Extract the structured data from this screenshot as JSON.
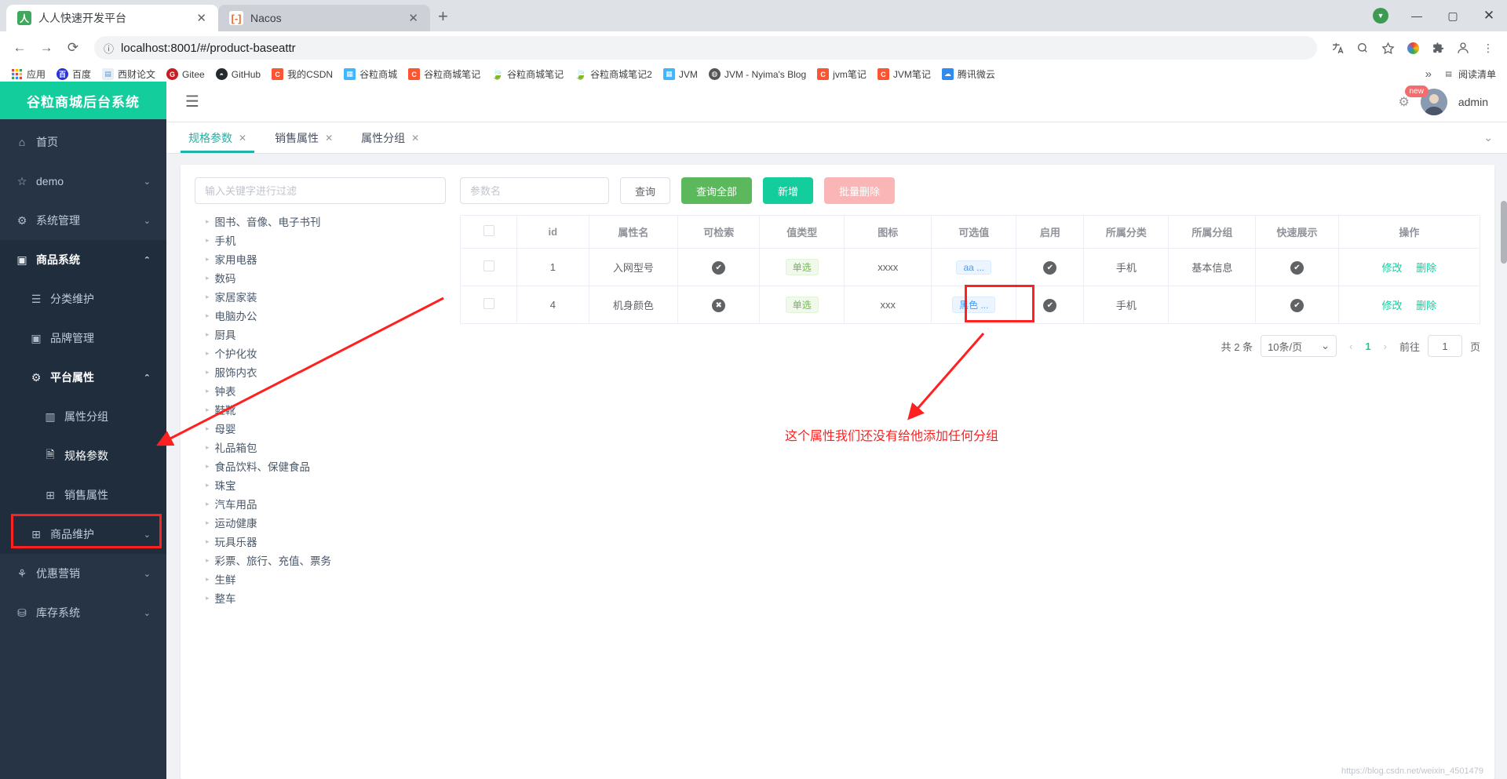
{
  "browser": {
    "tabs": [
      {
        "title": "人人快速开发平台",
        "favicon": "人",
        "active": true,
        "close": "✕"
      },
      {
        "title": "Nacos",
        "favicon": "[-]",
        "active": false,
        "close": "✕"
      }
    ],
    "newtab_label": "+",
    "window_controls": {
      "minimize": "—",
      "maximize": "▢",
      "close": "✕",
      "shield": "▼"
    },
    "nav": {
      "back": "←",
      "forward": "→",
      "reload": "⟳"
    },
    "url": "localhost:8001/#/product-baseattr",
    "url_info_icon": "ⓘ",
    "toolbar_icons": [
      "translate-icon",
      "search-icon",
      "star-icon",
      "extension-puzzle-icon",
      "profile-icon"
    ],
    "bookmarks": [
      {
        "label": "应用",
        "icon": "apps-grid-icon",
        "color": "#4285f4"
      },
      {
        "label": "百度",
        "icon": "baidu-icon",
        "color": "#2932e1"
      },
      {
        "label": "西财论文",
        "icon": "document-icon",
        "color": "#5b9bd5"
      },
      {
        "label": "Gitee",
        "icon": "gitee-icon",
        "color": "#c71d23"
      },
      {
        "label": "GitHub",
        "icon": "github-icon",
        "color": "#24292e"
      },
      {
        "label": "我的CSDN",
        "icon": "csdn-icon",
        "color": "#fc5531"
      },
      {
        "label": "谷粒商城",
        "icon": "calendar-icon",
        "color": "#41b6ff"
      },
      {
        "label": "谷粒商城笔记",
        "icon": "csdn-icon",
        "color": "#fc5531"
      },
      {
        "label": "谷粒商城笔记",
        "icon": "leaf-icon",
        "color": "#3cb371"
      },
      {
        "label": "谷粒商城笔记2",
        "icon": "leaf-icon",
        "color": "#3cb371"
      },
      {
        "label": "JVM",
        "icon": "calendar-icon",
        "color": "#41b6ff"
      },
      {
        "label": "JVM - Nyima's Blog",
        "icon": "globe-icon",
        "color": "#555555"
      },
      {
        "label": "jvm笔记",
        "icon": "csdn-icon",
        "color": "#fc5531"
      },
      {
        "label": "JVM笔记",
        "icon": "csdn-icon",
        "color": "#fc5531"
      },
      {
        "label": "腾讯微云",
        "icon": "cloud-icon",
        "color": "#2e8bf0"
      }
    ],
    "bookmarks_overflow": "»",
    "reading_list": "阅读清单"
  },
  "app": {
    "logo": "谷粒商城后台系统",
    "hamburger": "☰",
    "user": {
      "name": "admin",
      "badge": "new",
      "gear": "⚙"
    },
    "sidebar": [
      {
        "label": "首页",
        "icon": "home-icon",
        "level": 1,
        "expandable": false
      },
      {
        "label": "demo",
        "icon": "star-icon",
        "level": 1,
        "expandable": true,
        "chevron": "⌄"
      },
      {
        "label": "系统管理",
        "icon": "gear-icon",
        "level": 1,
        "expandable": true,
        "chevron": "⌄"
      },
      {
        "label": "商品系统",
        "icon": "box-icon",
        "level": 1,
        "expandable": true,
        "chevron": "⌃",
        "open": true
      },
      {
        "label": "分类维护",
        "icon": "list-icon",
        "level": 2,
        "expandable": false
      },
      {
        "label": "品牌管理",
        "icon": "box-icon",
        "level": 2,
        "expandable": false
      },
      {
        "label": "平台属性",
        "icon": "gear-icon",
        "level": 2,
        "expandable": true,
        "chevron": "⌃",
        "open": true
      },
      {
        "label": "属性分组",
        "icon": "chart-icon",
        "level": 3,
        "expandable": false
      },
      {
        "label": "规格参数",
        "icon": "file-icon",
        "level": 3,
        "expandable": false,
        "selected": true
      },
      {
        "label": "销售属性",
        "icon": "grid-icon",
        "level": 3,
        "expandable": false
      },
      {
        "label": "商品维护",
        "icon": "grid-icon",
        "level": 2,
        "expandable": true,
        "chevron": "⌄"
      },
      {
        "label": "优惠营销",
        "icon": "tag-icon",
        "level": 1,
        "expandable": true,
        "chevron": "⌄"
      },
      {
        "label": "库存系统",
        "icon": "warehouse-icon",
        "level": 1,
        "expandable": true,
        "chevron": "⌄"
      }
    ],
    "view_tabs": [
      {
        "label": "规格参数",
        "active": true,
        "close": "✕"
      },
      {
        "label": "销售属性",
        "active": false,
        "close": "✕"
      },
      {
        "label": "属性分组",
        "active": false,
        "close": "✕"
      }
    ],
    "view_tabs_more": "⌄",
    "tree": {
      "filter_placeholder": "输入关键字进行过滤",
      "filter_value": "",
      "caret": "▸",
      "nodes": [
        "图书、音像、电子书刊",
        "手机",
        "家用电器",
        "数码",
        "家居家装",
        "电脑办公",
        "厨具",
        "个护化妆",
        "服饰内衣",
        "钟表",
        "鞋靴",
        "母婴",
        "礼品箱包",
        "食品饮料、保健食品",
        "珠宝",
        "汽车用品",
        "运动健康",
        "玩具乐器",
        "彩票、旅行、充值、票务",
        "生鲜",
        "整车"
      ]
    },
    "toolbar": {
      "param_placeholder": "参数名",
      "param_value": "",
      "query_label": "查询",
      "query_all_label": "查询全部",
      "add_label": "新增",
      "batch_delete_label": "批量删除"
    },
    "table": {
      "columns": [
        "",
        "id",
        "属性名",
        "可检索",
        "值类型",
        "图标",
        "可选值",
        "启用",
        "所属分类",
        "所属分组",
        "快速展示",
        "操作"
      ],
      "rows": [
        {
          "id": "1",
          "name": "入网型号",
          "searchable": "✔",
          "value_type": "单选",
          "icon": "xxxx",
          "options": "aa ...",
          "enabled": "✔",
          "category": "手机",
          "group": "基本信息",
          "quick_show": "✔",
          "edit": "修改",
          "delete": "删除"
        },
        {
          "id": "4",
          "name": "机身颜色",
          "searchable": "✖",
          "value_type": "单选",
          "icon": "xxx",
          "options": "黑色 ...",
          "enabled": "✔",
          "category": "手机",
          "group": "",
          "quick_show": "✔",
          "edit": "修改",
          "delete": "删除"
        }
      ]
    },
    "pagination": {
      "total_text": "共 2 条",
      "page_size": "10条/页",
      "page_size_caret": "⌄",
      "prev": "‹",
      "next": "›",
      "current_page": "1",
      "goto_label": "前往",
      "goto_value": "1",
      "page_unit": "页"
    },
    "annotation": {
      "text": "这个属性我们还没有给他添加任何分组"
    },
    "watermark": "https://blog.csdn.net/weixin_4501479"
  },
  "colors": {
    "brand_teal": "#13ce9c",
    "green": "#5cb85c",
    "pink": "#fab6b6",
    "annotation_red": "#ff2020",
    "sidebar_bg": "#263445",
    "sidebar_sub_bg": "#1f2d3d"
  }
}
